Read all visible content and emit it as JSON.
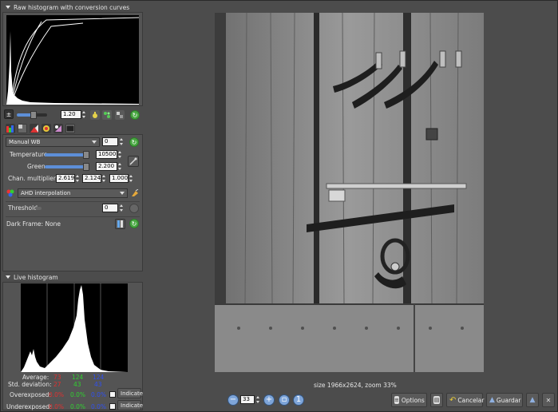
{
  "raw_histogram": {
    "title": "Raw histogram with conversion curves"
  },
  "exposure": {
    "value": "1.20",
    "slider_fraction": 0.55
  },
  "white_balance": {
    "mode": "Manual WB",
    "mode_value": "0",
    "temperature_label": "Temperature",
    "temperature_value": "10500",
    "temperature_fraction": 0.93,
    "green_label": "Green",
    "green_value": "2.200",
    "green_fraction": 0.93,
    "multipliers_label": "Chan. multipliers:",
    "multiplier_r": "2.619",
    "multiplier_g": "2.124",
    "multiplier_b": "1.000"
  },
  "interpolation": {
    "mode": "AHD interpolation",
    "threshold_label": "Threshold",
    "threshold_value": "0",
    "threshold_fraction": 0.0
  },
  "dark_frame": {
    "label": "Dark Frame: None"
  },
  "live_histogram": {
    "title": "Live histogram",
    "average_label": "Average:",
    "average": [
      "73",
      "124",
      "124"
    ],
    "std_label": "Std. deviation:",
    "std": [
      "27",
      "43",
      "43"
    ],
    "overexposed_label": "Overexposed:",
    "overexposed": [
      "0.0%",
      "0.0%",
      "0.0%"
    ],
    "underexposed_label": "Underexposed:",
    "underexposed": [
      "0.0%",
      "0.0%",
      "0.0%"
    ],
    "indicate_label": "Indicate"
  },
  "image_info": {
    "size_text": "size 1966x2624, zoom 33%"
  },
  "toolbar": {
    "zoom_value": "33",
    "options_label": "Options",
    "cancel_label": "Cancelar",
    "save_label": "Guardar"
  },
  "colors": {
    "red": "#e03030",
    "green": "#30d030",
    "blue": "#3050f0",
    "accent_green": "#49a842"
  }
}
